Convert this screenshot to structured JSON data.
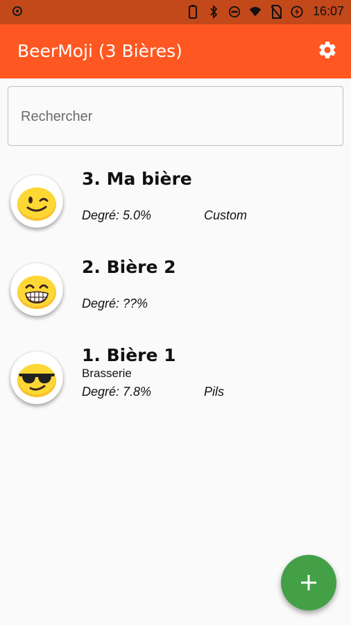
{
  "status_bar": {
    "time": "16:07",
    "icons": [
      "notification-dot-icon",
      "battery-outline-icon",
      "bluetooth-icon",
      "do-not-disturb-icon",
      "wifi-icon",
      "no-sim-icon",
      "battery-saver-icon"
    ]
  },
  "appbar": {
    "title": "BeerMoji (3 Bières)",
    "background": "#ff5722",
    "settings_icon": "gear-icon"
  },
  "search": {
    "placeholder": "Rechercher",
    "value": ""
  },
  "beers": [
    {
      "name": "3. Ma bière",
      "brewery": "",
      "degree": "Degré: 5.0%",
      "type": "Custom",
      "emoji": "winking-face-emoji"
    },
    {
      "name": "2. Bière 2",
      "brewery": "",
      "degree": "Degré: ??%",
      "type": "",
      "emoji": "grinning-face-emoji"
    },
    {
      "name": "1. Bière 1",
      "brewery": "Brasserie",
      "degree": "Degré: 7.8%",
      "type": "Pils",
      "emoji": "sunglasses-face-emoji"
    }
  ],
  "fab": {
    "icon": "plus-icon",
    "color": "#43a047"
  }
}
